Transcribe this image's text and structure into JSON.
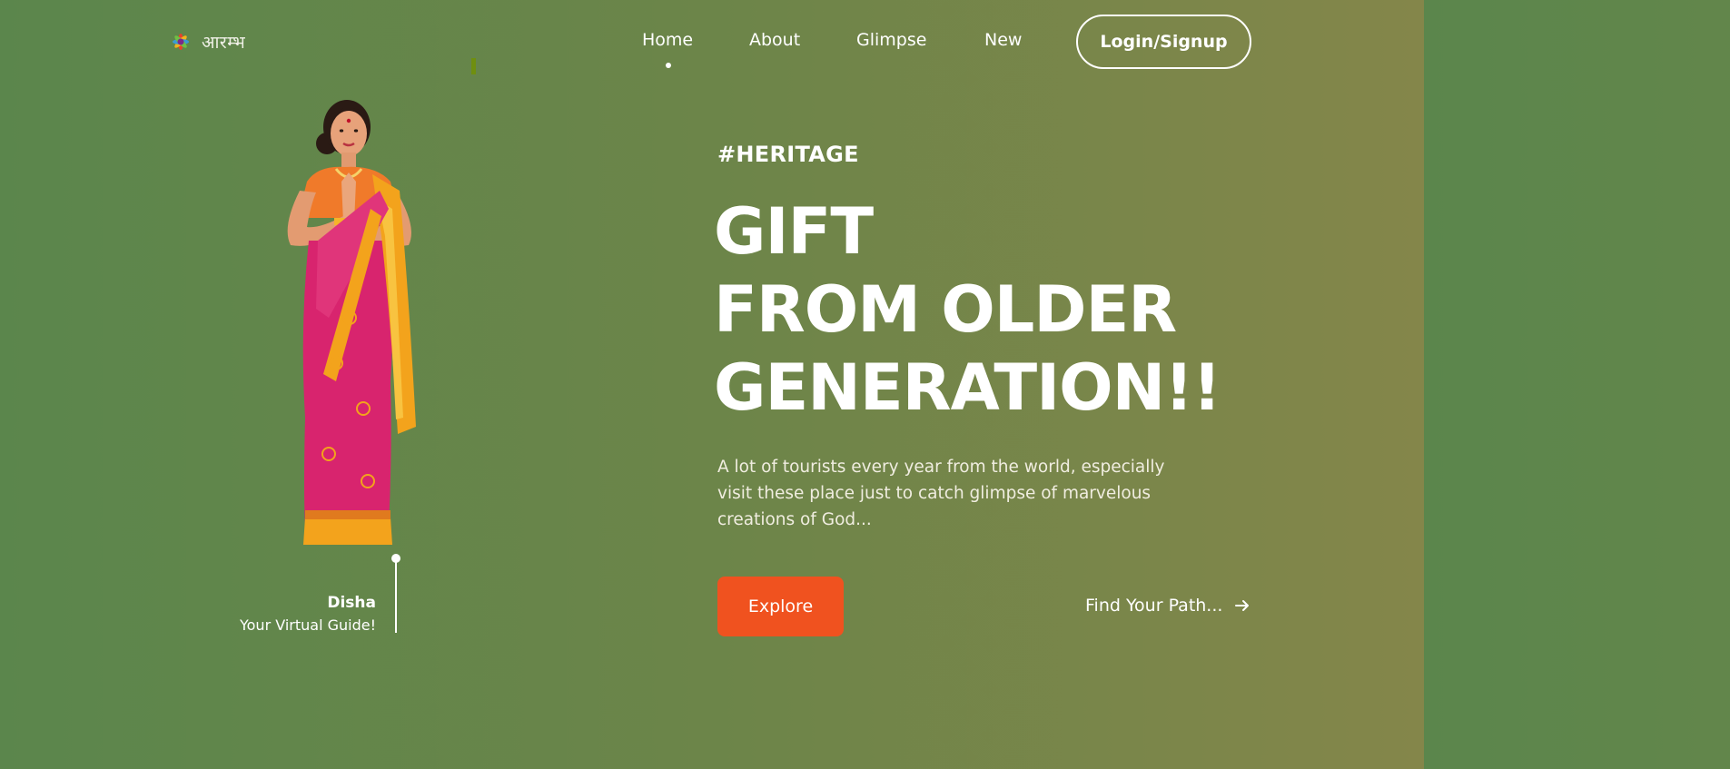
{
  "brand": {
    "logo_icon": "flower-mandala-icon",
    "name": "आरम्भ"
  },
  "nav": {
    "items": [
      {
        "label": "Home",
        "active": true
      },
      {
        "label": "About",
        "active": false
      },
      {
        "label": "Glimpse",
        "active": false
      },
      {
        "label": "New",
        "active": false
      }
    ],
    "login_label": "Login/Signup"
  },
  "guide": {
    "name": "Disha",
    "role": "Your Virtual Guide!",
    "illustration_icon": "woman-in-saree-namaste-illustration"
  },
  "hero": {
    "tag": "#HERITAGE",
    "title_lines": [
      "GIFT",
      "FROM OLDER",
      "GENERATION!!"
    ],
    "description": "A lot of tourists every year from the world, especially visit these place just to catch glimpse of marvelous creations of God...",
    "explore_label": "Explore",
    "find_path_label": "Find Your Path...",
    "find_path_icon": "arrow-right-icon"
  },
  "colors": {
    "background_start": "#5b864c",
    "background_end": "#84864a",
    "accent": "#f0521f",
    "text": "#ffffff",
    "saree_pink": "#d8246e",
    "saree_gold": "#f3a31c"
  }
}
